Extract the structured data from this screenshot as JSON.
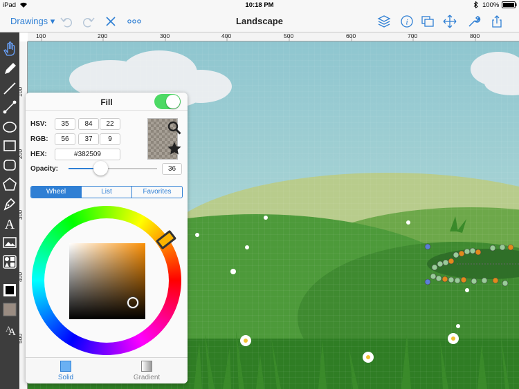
{
  "status_bar": {
    "carrier": "iPad",
    "time": "10:18 PM",
    "battery": "100%"
  },
  "nav": {
    "drawings_label": "Drawings ▾",
    "title": "Landscape",
    "left_icons": [
      "undo-icon",
      "redo-icon",
      "close-icon",
      "more-icon"
    ],
    "right_icons": [
      "layers-icon",
      "info-icon",
      "arrange-icon",
      "move-icon",
      "wrench-icon",
      "share-icon"
    ]
  },
  "ruler": {
    "top_labels": [
      "100",
      "200",
      "300",
      "400",
      "500",
      "600",
      "700",
      "800"
    ],
    "left_labels": [
      "100",
      "200",
      "300",
      "400",
      "500"
    ]
  },
  "tools": [
    "hand-icon",
    "pencil-icon",
    "line-icon",
    "connector-icon",
    "ellipse-icon",
    "rectangle-icon",
    "rounded-rect-icon",
    "polygon-icon",
    "pen-icon",
    "text-icon",
    "image-icon",
    "shapes-library-icon",
    "stroke-color-icon",
    "fill-color-icon",
    "text-style-icon"
  ],
  "fill": {
    "title": "Fill",
    "enabled": true,
    "hsv_label": "HSV:",
    "hsv": [
      "35",
      "84",
      "22"
    ],
    "rgb_label": "RGB:",
    "rgb": [
      "56",
      "37",
      "9"
    ],
    "hex_label": "HEX:",
    "hex": "#382509",
    "opacity_label": "Opacity:",
    "opacity": "36",
    "opacity_fraction": 0.36,
    "color": "#382509",
    "hue_color": "#fa8f05",
    "accent": "#2f7fd4",
    "segments": [
      "Wheel",
      "List",
      "Favorites"
    ],
    "active_segment": "Wheel",
    "tabs": [
      "Solid",
      "Gradient"
    ],
    "active_tab": "Solid"
  }
}
